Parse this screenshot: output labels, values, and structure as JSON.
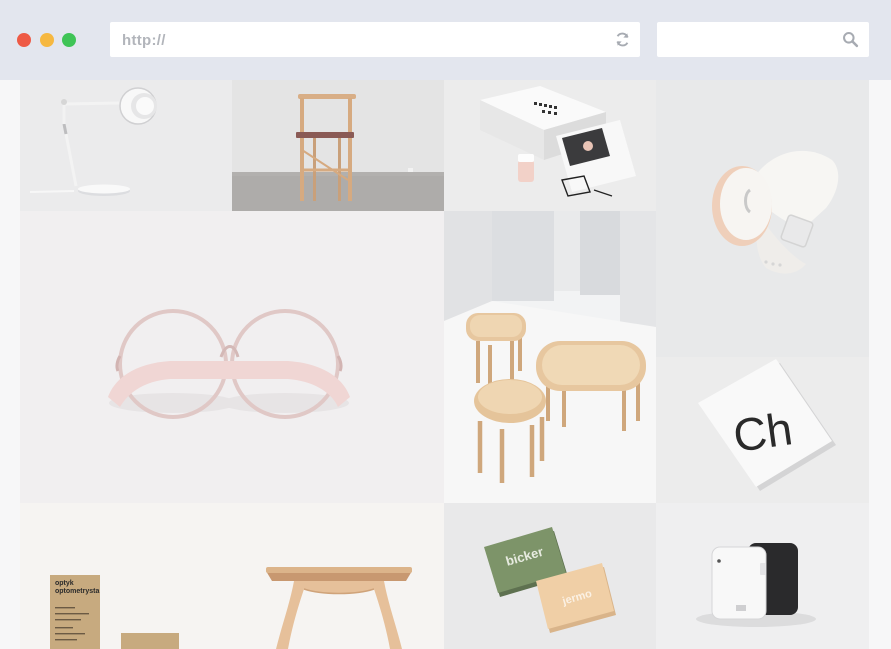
{
  "browser": {
    "address_bar": {
      "value": "http://"
    },
    "search_box": {
      "value": ""
    },
    "window_controls": [
      "close",
      "minimize",
      "maximize"
    ],
    "icons": {
      "reload": "reload-icon",
      "search": "search-icon"
    }
  },
  "gallery": {
    "items": [
      {
        "subject": "desk lamp"
      },
      {
        "subject": "wooden chair"
      },
      {
        "subject": "stationery packaging"
      },
      {
        "subject": "wristwatch"
      },
      {
        "subject": "round glasses"
      },
      {
        "subject": "wooden side tables"
      },
      {
        "subject": "typography card",
        "text": "Ch"
      },
      {
        "subject": "business cards",
        "texts": [
          "optyk",
          "optometrysta"
        ]
      },
      {
        "subject": "wooden stool"
      },
      {
        "subject": "business cards",
        "texts": [
          "bicker",
          "jermo"
        ]
      },
      {
        "subject": "electronic device"
      }
    ]
  },
  "colors": {
    "chrome": "#e3e6ee",
    "close": "#ee5a45",
    "minimize": "#f6b840",
    "maximize": "#3fc456",
    "card_green": "#7d9469",
    "card_peach": "#f0cfa6"
  }
}
